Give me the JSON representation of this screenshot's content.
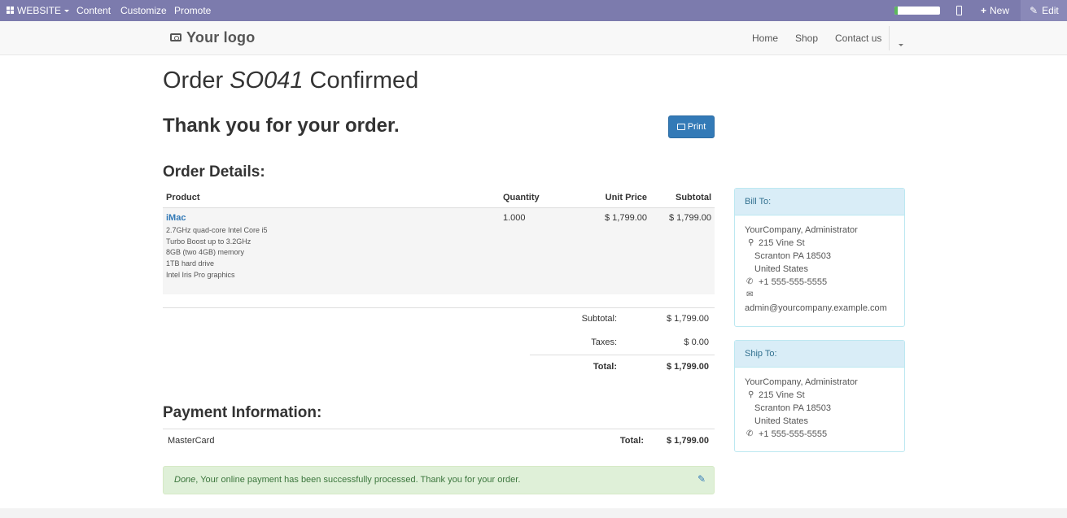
{
  "adminbar": {
    "website_label": "WEBSITE",
    "content_label": "Content",
    "customize_label": "Customize",
    "promote_label": "Promote",
    "progress_fraction": 0.08,
    "new_label": "New",
    "edit_label": "Edit"
  },
  "navbar": {
    "logo": "Your logo",
    "links": [
      "Home",
      "Shop",
      "Contact us"
    ]
  },
  "order": {
    "title_prefix": "Order ",
    "number": "SO041",
    "title_suffix": " Confirmed",
    "thanks": "Thank you for your order.",
    "print_label": "Print"
  },
  "details": {
    "heading": "Order Details:",
    "columns": [
      "Product",
      "Quantity",
      "Unit Price",
      "Subtotal"
    ],
    "row": {
      "product": "iMac",
      "description": [
        "2.7GHz quad-core Intel Core i5",
        "Turbo Boost up to 3.2GHz",
        "8GB (two 4GB) memory",
        "1TB hard drive",
        "Intel Iris Pro graphics"
      ],
      "quantity": "1.000",
      "unit_price": "$ 1,799.00",
      "subtotal": "$ 1,799.00"
    },
    "summary": {
      "subtotal_label": "Subtotal:",
      "subtotal_value": "$ 1,799.00",
      "taxes_label": "Taxes:",
      "taxes_value": "$ 0.00",
      "total_label": "Total:",
      "total_value": "$ 1,799.00"
    }
  },
  "payment": {
    "heading": "Payment Information:",
    "method": "MasterCard",
    "total_label": "Total:",
    "total_value": "$ 1,799.00",
    "status_word": "Done",
    "message": ", Your online payment has been successfully processed. Thank you for your order."
  },
  "bill_to": {
    "heading": "Bill To:",
    "name": "YourCompany, Administrator",
    "street": "215 Vine St",
    "city": "Scranton PA 18503",
    "country": "United States",
    "phone": "+1 555-555-5555",
    "email": "admin@yourcompany.example.com"
  },
  "ship_to": {
    "heading": "Ship To:",
    "name": "YourCompany, Administrator",
    "street": "215 Vine St",
    "city": "Scranton PA 18503",
    "country": "United States",
    "phone": "+1 555-555-5555"
  },
  "colors": {
    "admin_bar": "#7c7bad",
    "link_blue": "#337ab7",
    "success_bg": "#dff0d8",
    "info_bg": "#d9edf7"
  }
}
